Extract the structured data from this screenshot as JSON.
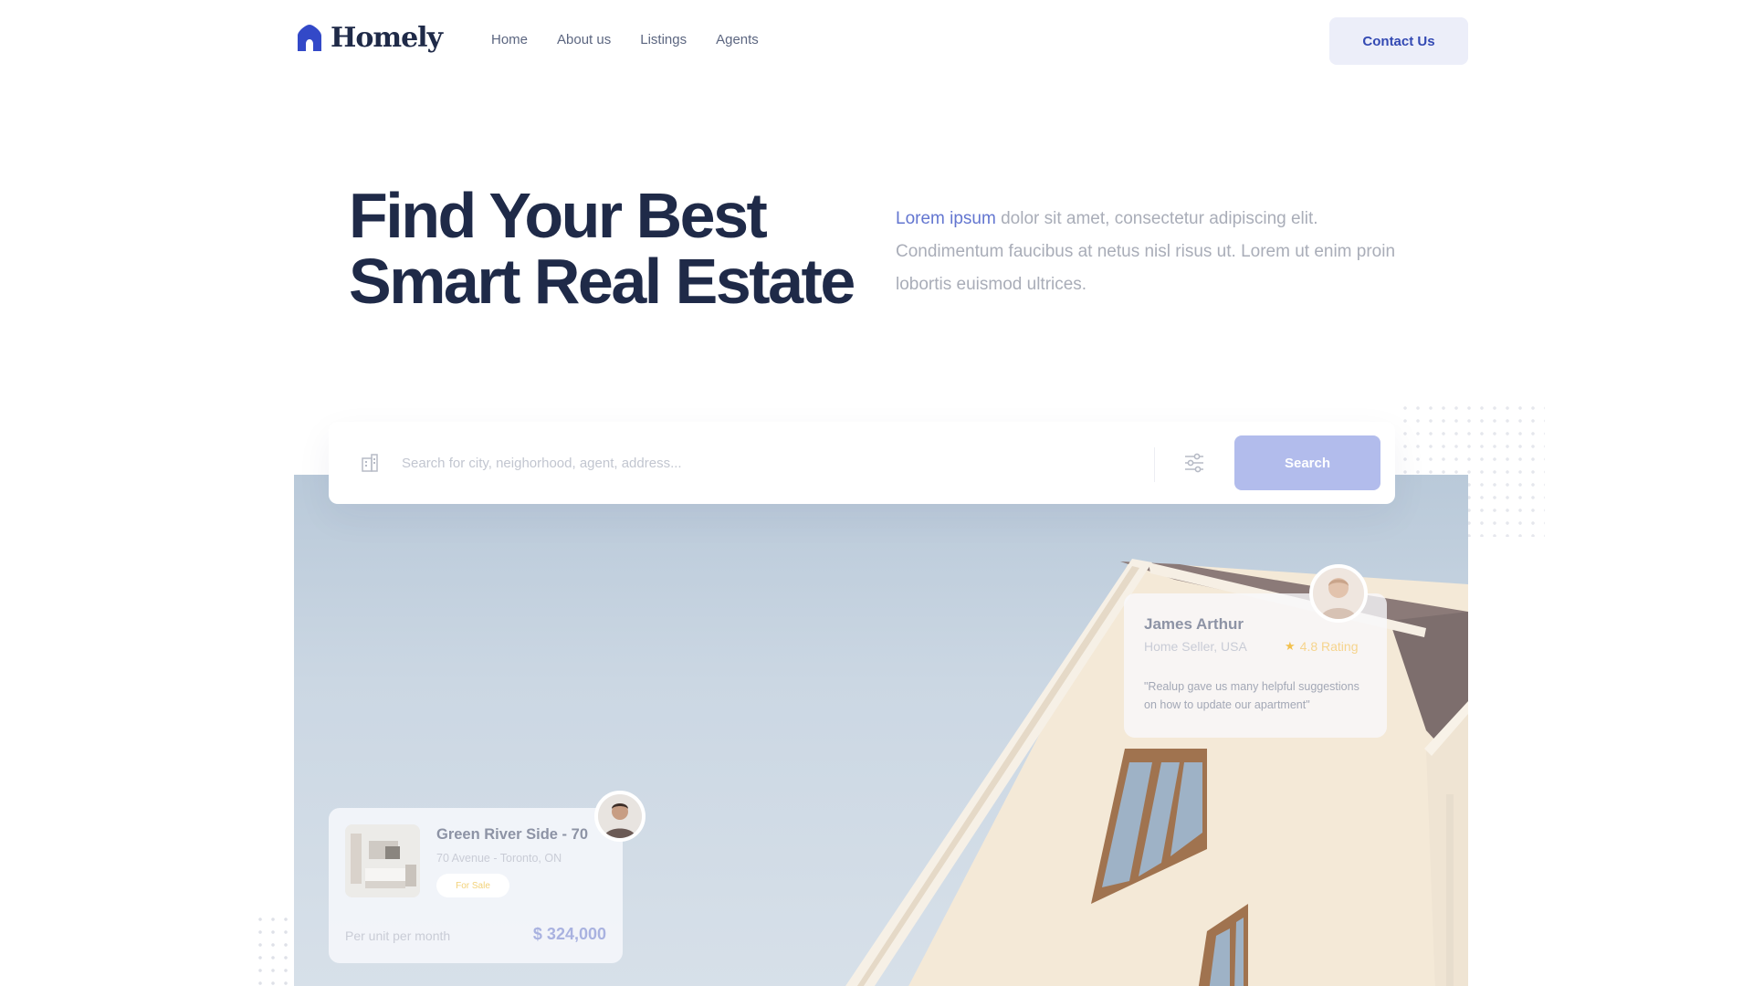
{
  "brand": {
    "name": "Homely",
    "color": "#3349b3"
  },
  "nav": {
    "items": [
      "Home",
      "About us",
      "Listings",
      "Agents"
    ],
    "contact_label": "Contact Us"
  },
  "hero": {
    "title_line1": "Find Your Best",
    "title_line2": "Smart Real Estate",
    "desc_accent": "Lorem ipsum",
    "desc_rest": " dolor sit amet, consectetur adipiscing elit. Condimentum faucibus at netus nisl risus ut. Lorem ut enim proin lobortis euismod ultrices."
  },
  "search": {
    "placeholder": "Search for city, neighorhood, agent, address...",
    "button_label": "Search",
    "icons": {
      "location": "building-icon",
      "filter": "sliders-icon"
    }
  },
  "testimonial": {
    "name": "James Arthur",
    "role": "Home Seller, USA",
    "rating": "4.8 Rating",
    "quote": "\"Realup gave us many helpful suggestions on how to update our apartment\""
  },
  "listing": {
    "title": "Green River Side - 70",
    "address": "70 Avenue - Toronto, ON",
    "badge": "For Sale",
    "unit_label": "Per unit per month",
    "price": "$ 324,000"
  },
  "colors": {
    "accent": "#6376d0",
    "heading": "#1f2a48",
    "star": "#f2c14e"
  }
}
